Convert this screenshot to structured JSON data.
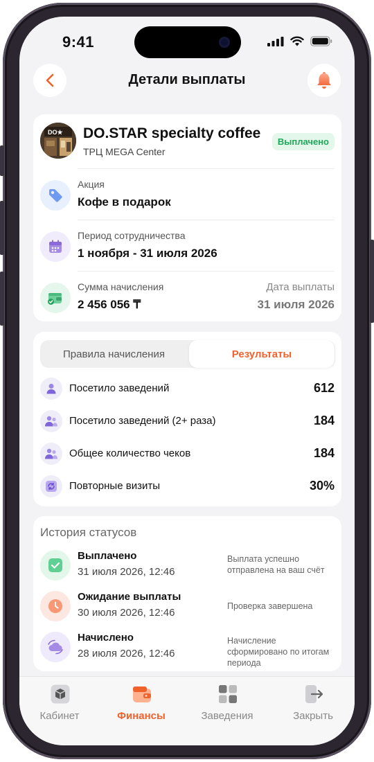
{
  "status_bar": {
    "time": "9:41"
  },
  "header": {
    "title": "Детали выплаты",
    "back_icon": "chevron-left-icon",
    "bell_icon": "bell-icon",
    "accent": "#f0622c"
  },
  "merchant": {
    "name": "DO.STAR specialty coffee",
    "location": "ТРЦ MEGA Center",
    "status_badge": "Выплачено",
    "status_color": "#1ea85a"
  },
  "details": {
    "promo": {
      "label": "Акция",
      "value": "Кофе в подарок",
      "icon": "tag-icon"
    },
    "period": {
      "label": "Период сотрудничества",
      "value": "1 ноября - 31 июля 2026",
      "icon": "calendar-icon"
    },
    "amount": {
      "label": "Сумма начисления",
      "value": "2 456 056 ₸",
      "icon": "wallet-icon"
    },
    "payout_date": {
      "label": "Дата выплаты",
      "value": "31 июля 2026"
    }
  },
  "tabs": [
    {
      "label": "Правила начисления",
      "active": false
    },
    {
      "label": "Результаты",
      "active": true
    }
  ],
  "metrics": [
    {
      "label": "Посетило заведений",
      "value": "612",
      "icon": "user-icon"
    },
    {
      "label": "Посетило заведений (2+ раза)",
      "value": "184",
      "icon": "users-icon"
    },
    {
      "label": "Общее количество чеков",
      "value": "184",
      "icon": "users-icon"
    },
    {
      "label": "Повторные визиты",
      "value": "30%",
      "icon": "repeat-icon"
    }
  ],
  "history": {
    "title": "История статусов",
    "items": [
      {
        "status": "Выплачено",
        "date": "31 июля 2026, 12:46",
        "description": "Выплата успешно отправлена на ваш счёт",
        "icon": "check-icon"
      },
      {
        "status": "Ожидание выплаты",
        "date": "30 июля 2026, 12:46",
        "description": "Проверка завершена",
        "icon": "clock-icon"
      },
      {
        "status": "Начислено",
        "date": "28 июля 2026, 12:46",
        "description": "Начисление сформировано по итогам периода",
        "icon": "cloud-sync-icon"
      }
    ]
  },
  "nav": [
    {
      "label": "Кабинет",
      "icon": "box-icon",
      "active": false
    },
    {
      "label": "Финансы",
      "icon": "wallet-icon",
      "active": true
    },
    {
      "label": "Заведения",
      "icon": "grid-icon",
      "active": false
    },
    {
      "label": "Закрыть",
      "icon": "logout-icon",
      "active": false
    }
  ]
}
